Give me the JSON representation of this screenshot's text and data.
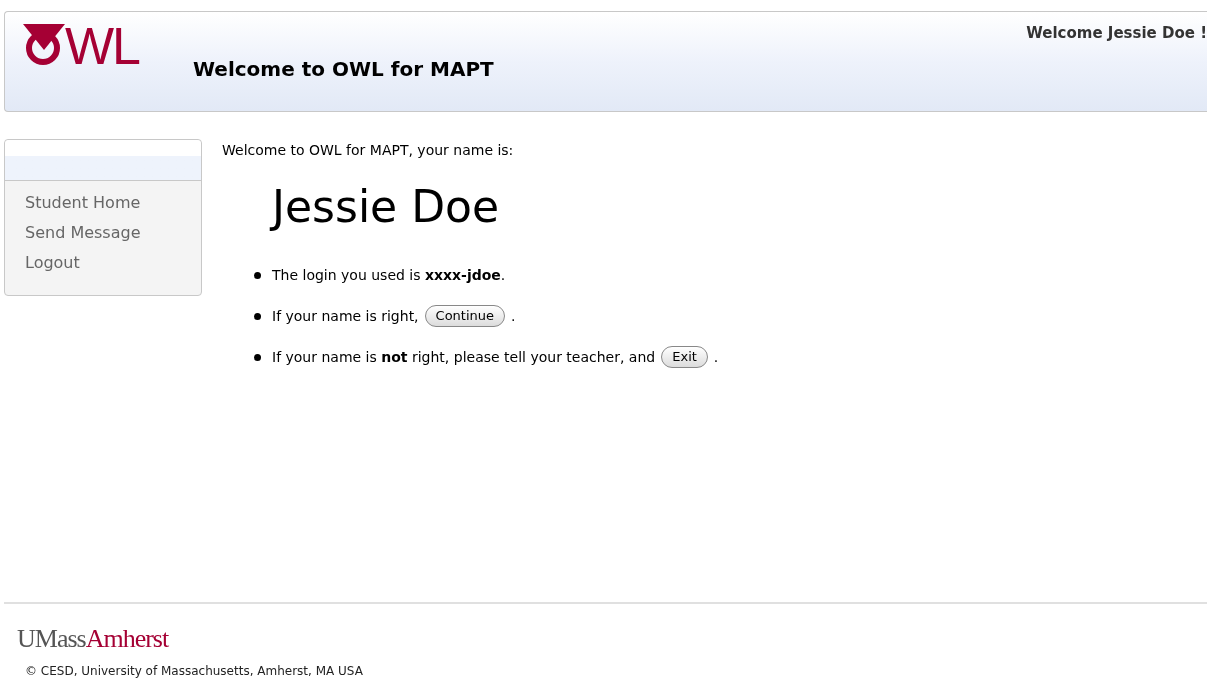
{
  "header": {
    "logo": "WL",
    "title": "Welcome to OWL for MAPT",
    "greeting": "Welcome Jessie Doe !"
  },
  "sidebar": {
    "items": [
      {
        "label": "Student Home"
      },
      {
        "label": "Send Message"
      },
      {
        "label": "Logout"
      }
    ]
  },
  "main": {
    "intro": "Welcome to OWL for MAPT, your name is:",
    "name": "Jessie Doe",
    "items": [
      {
        "text": "The login you used is **xxxx-jdoe**."
      },
      {
        "text": "If your name is right,",
        "button": "Continue",
        "after": "."
      },
      {
        "text": "If your name is **not** right, please tell your teacher, and",
        "button": "Exit",
        "after": "."
      }
    ]
  },
  "footer": {
    "logo_left": "UMass",
    "logo_right": "Amherst",
    "copyright": "© CESD, University of Massachusetts, Amherst, MA USA"
  }
}
